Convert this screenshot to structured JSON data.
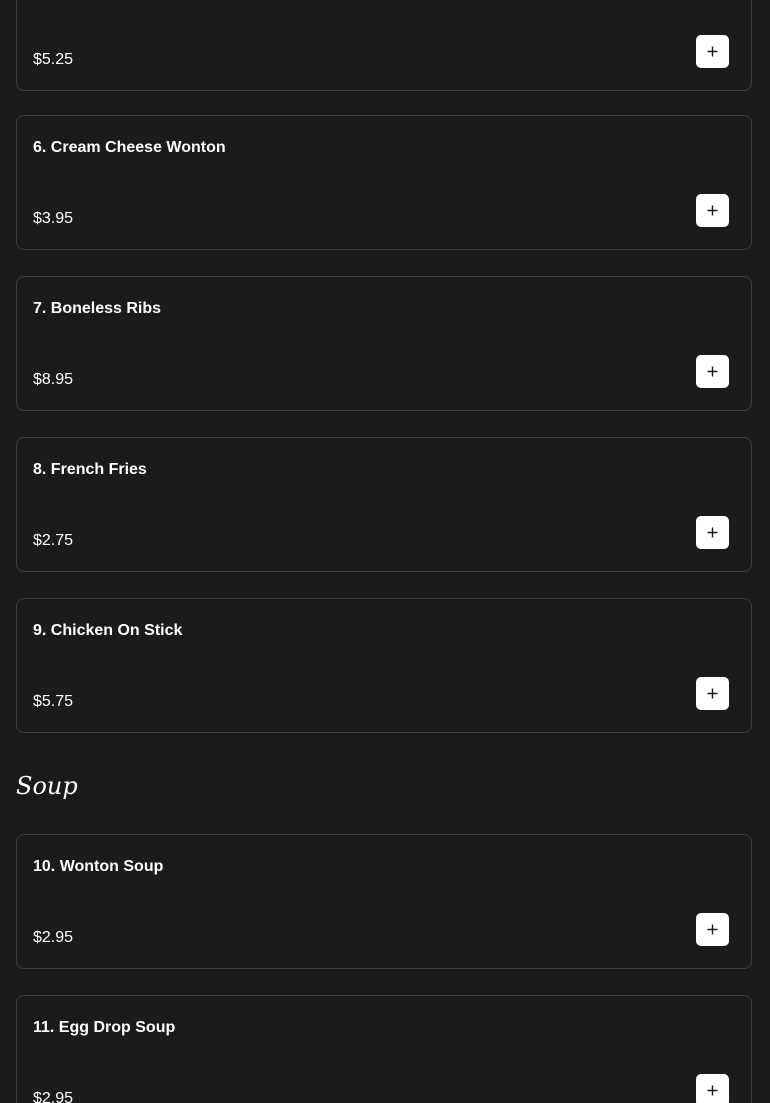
{
  "menu": {
    "items": [
      {
        "name": "",
        "price": "$5.25"
      },
      {
        "name": "6. Cream Cheese Wonton",
        "price": "$3.95"
      },
      {
        "name": "7. Boneless Ribs",
        "price": "$8.95"
      },
      {
        "name": "8. French Fries",
        "price": "$2.75"
      },
      {
        "name": "9. Chicken On Stick",
        "price": "$5.75"
      }
    ],
    "soup_section": {
      "title": "Soup",
      "items": [
        {
          "name": "10. Wonton Soup",
          "price": "$2.95"
        },
        {
          "name": "11. Egg Drop Soup",
          "price": "$2.95"
        }
      ]
    }
  },
  "icons": {
    "add": "plus-icon"
  },
  "colors": {
    "background": "#1a1a1a",
    "card_border": "#3d3d3d",
    "text": "#ffffff",
    "button_bg": "#ffffff",
    "button_icon": "#1a1a1a"
  }
}
